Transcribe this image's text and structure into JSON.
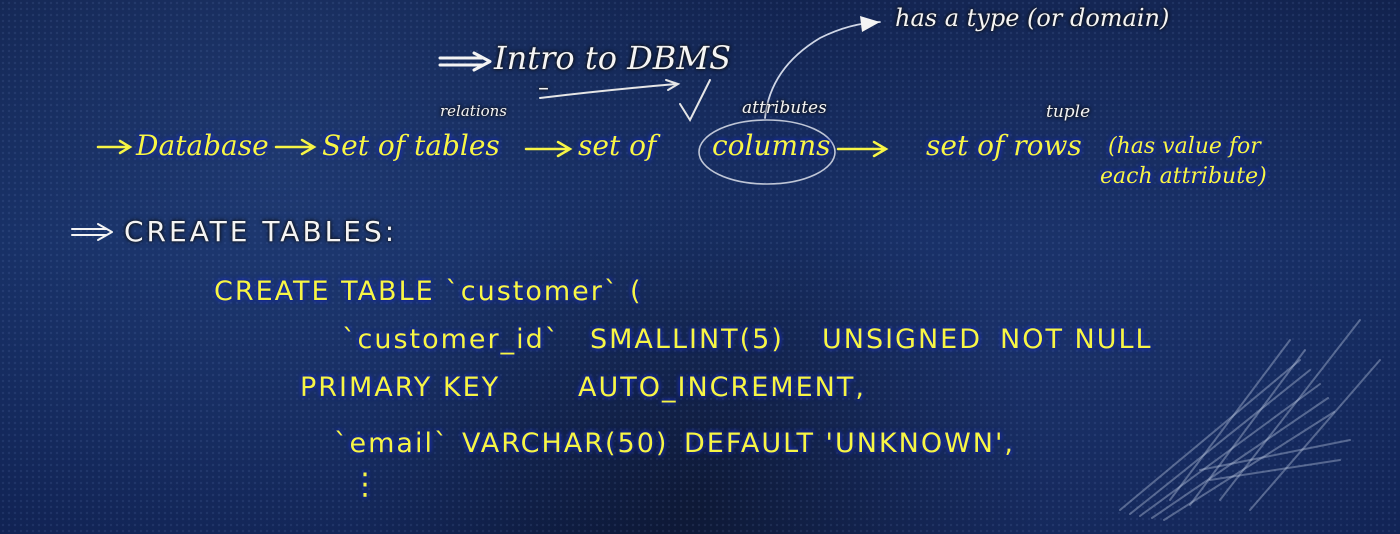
{
  "title": "Intro to DBMS",
  "annotations": {
    "type_note": "has a type (or domain)",
    "relations": "relations",
    "attributes": "attributes",
    "tuple": "tuple"
  },
  "hierarchy": {
    "database": "Database",
    "set_of_tables": "Set of tables",
    "set_of_columns_prefix": "set of",
    "columns": "columns",
    "set_of_rows": "set of rows",
    "row_note_line1": "(has value for",
    "row_note_line2": "each attribute)"
  },
  "section_heading": "CREATE TABLES:",
  "sql": {
    "line1": "CREATE TABLE `customer` (",
    "line2_col": "`customer_id`",
    "line2_type": "SMALLINT(5)",
    "line2_unsigned": "UNSIGNED",
    "line2_notnull": "NOT NULL",
    "line3_pk": "PRIMARY KEY",
    "line3_ai": "AUTO_INCREMENT,",
    "line4_col": "`email`",
    "line4_type": "VARCHAR(50)",
    "line4_default": "DEFAULT 'UNKNOWN',",
    "continuation": "⋮"
  },
  "colors": {
    "board": "#10204a",
    "chalk_yellow": "#f7f545",
    "chalk_white": "#f4f4f4"
  }
}
